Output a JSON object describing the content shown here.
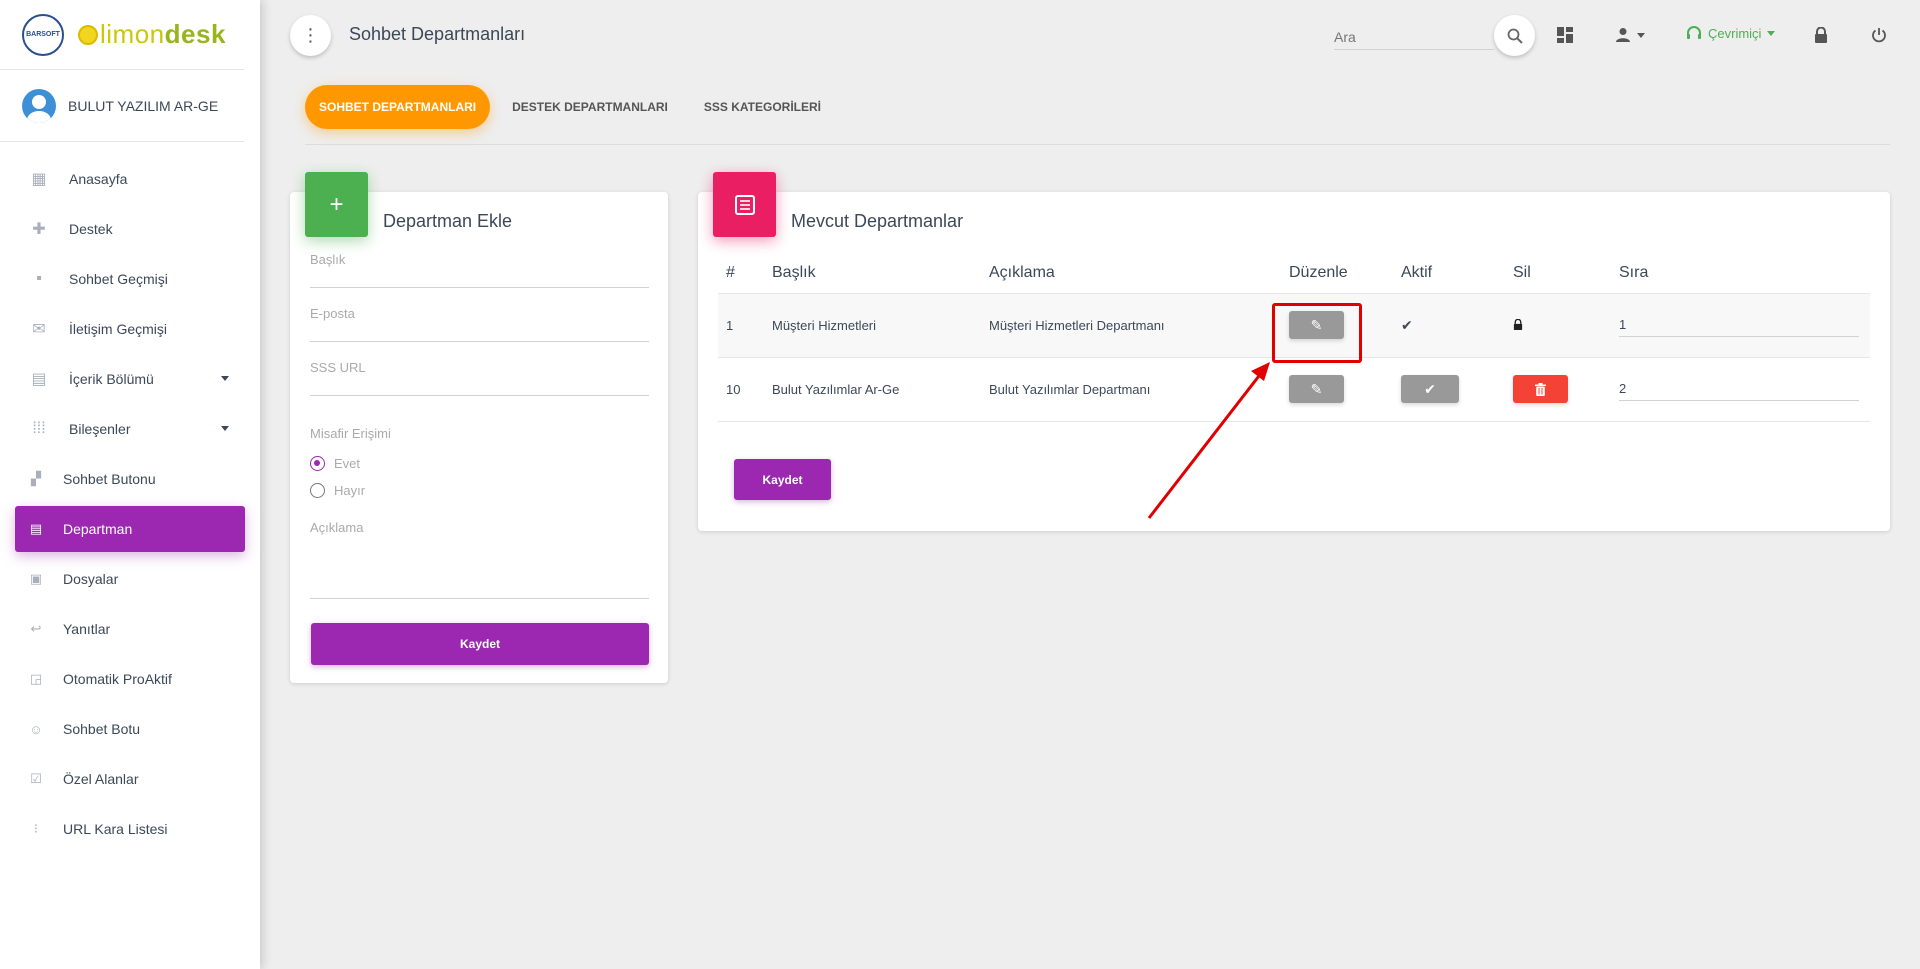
{
  "sidebar": {
    "brand": {
      "seal": "BARSOFT",
      "name_a": "limon",
      "name_b": "desk"
    },
    "user_name": "BULUT YAZILIM AR-GE",
    "items": [
      {
        "label": "Anasayfa",
        "icon": "dashboard-icon"
      },
      {
        "label": "Destek",
        "icon": "bandage-icon"
      },
      {
        "label": "Sohbet Geçmişi",
        "icon": "chat-icon"
      },
      {
        "label": "İletişim Geçmişi",
        "icon": "mail-icon"
      },
      {
        "label": "İçerik Bölümü",
        "icon": "content-icon"
      },
      {
        "label": "Bileşenler",
        "icon": "grid-icon"
      },
      {
        "label": "Sohbet Butonu",
        "icon": "widgets-icon"
      },
      {
        "label": "Departman",
        "icon": "list-icon"
      },
      {
        "label": "Dosyalar",
        "icon": "folder-icon"
      },
      {
        "label": "Yanıtlar",
        "icon": "reply-icon"
      },
      {
        "label": "Otomatik ProAktif",
        "icon": "cast-icon"
      },
      {
        "label": "Sohbet Botu",
        "icon": "smile-icon"
      },
      {
        "label": "Özel Alanlar",
        "icon": "checkbox-icon"
      },
      {
        "label": "URL Kara Listesi",
        "icon": "traffic-icon"
      }
    ]
  },
  "header": {
    "title": "Sohbet Departmanları",
    "search_placeholder": "Ara",
    "status": "Çevrimiçi"
  },
  "tabs": [
    {
      "label": "SOHBET DEPARTMANLARI"
    },
    {
      "label": "DESTEK DEPARTMANLARI"
    },
    {
      "label": "SSS KATEGORİLERİ"
    }
  ],
  "add_form": {
    "title": "Departman Ekle",
    "fields": {
      "title": "Başlık",
      "email": "E-posta",
      "faq_url": "SSS URL",
      "guest_access": "Misafir Erişimi",
      "yes": "Evet",
      "no": "Hayır",
      "description": "Açıklama"
    },
    "guest_access_value": "Evet",
    "save": "Kaydet"
  },
  "list": {
    "title": "Mevcut Departmanlar",
    "columns": [
      "#",
      "Başlık",
      "Açıklama",
      "Düzenle",
      "Aktif",
      "Sil",
      "Sıra"
    ],
    "rows": [
      {
        "id": "1",
        "title": "Müşteri Hizmetleri",
        "desc": "Müşteri Hizmetleri Departmanı",
        "order": "1"
      },
      {
        "id": "10",
        "title": "Bulut Yazılımlar Ar-Ge",
        "desc": "Bulut Yazılımlar Departmanı",
        "order": "2"
      }
    ],
    "save": "Kaydet"
  },
  "colors": {
    "primary": "#9c27b0",
    "tab_active": "#ff9800",
    "add_icon": "#4caf50",
    "list_icon": "#e91e63",
    "delete": "#f44336",
    "highlight": "#e00000"
  }
}
